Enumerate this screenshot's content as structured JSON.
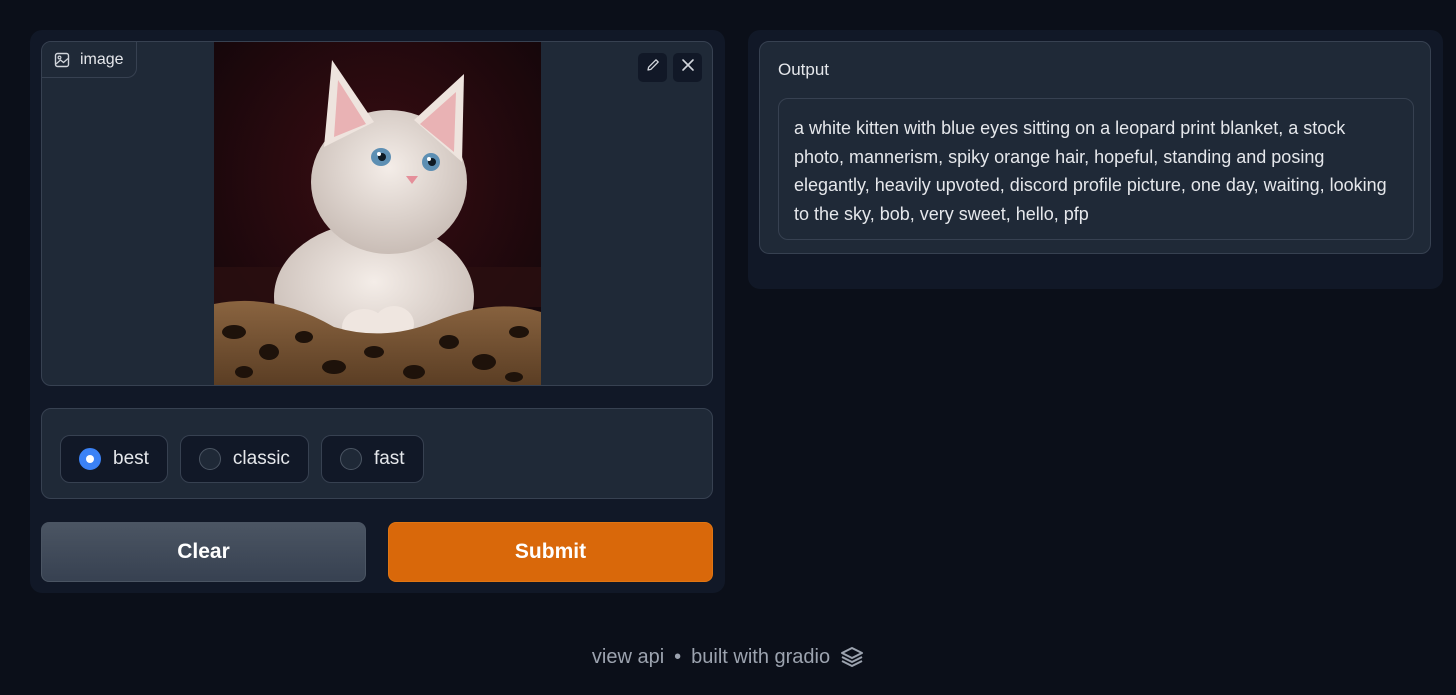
{
  "image_input": {
    "label": "image",
    "icon": "image-icon",
    "edit_icon": "pencil-icon",
    "close_icon": "close-icon"
  },
  "mode_options": [
    {
      "label": "best",
      "checked": true
    },
    {
      "label": "classic",
      "checked": false
    },
    {
      "label": "fast",
      "checked": false
    }
  ],
  "buttons": {
    "clear_label": "Clear",
    "submit_label": "Submit"
  },
  "output": {
    "label": "Output",
    "text": "a white kitten with blue eyes sitting on a leopard print blanket, a stock photo, mannerism, spiky orange hair, hopeful, standing and posing elegantly, heavily upvoted, discord profile picture, one day, waiting, looking to the sky, bob, very sweet, hello, pfp"
  },
  "footer": {
    "view_api": "view api",
    "separator": "•",
    "built_with": "built with gradio",
    "logo_icon": "gradio-logo-icon"
  },
  "colors": {
    "background": "#0b0f19",
    "panel": "#111827",
    "block": "#1f2937",
    "accent_orange": "#d9680a",
    "radio_checked": "#3b82f6"
  }
}
